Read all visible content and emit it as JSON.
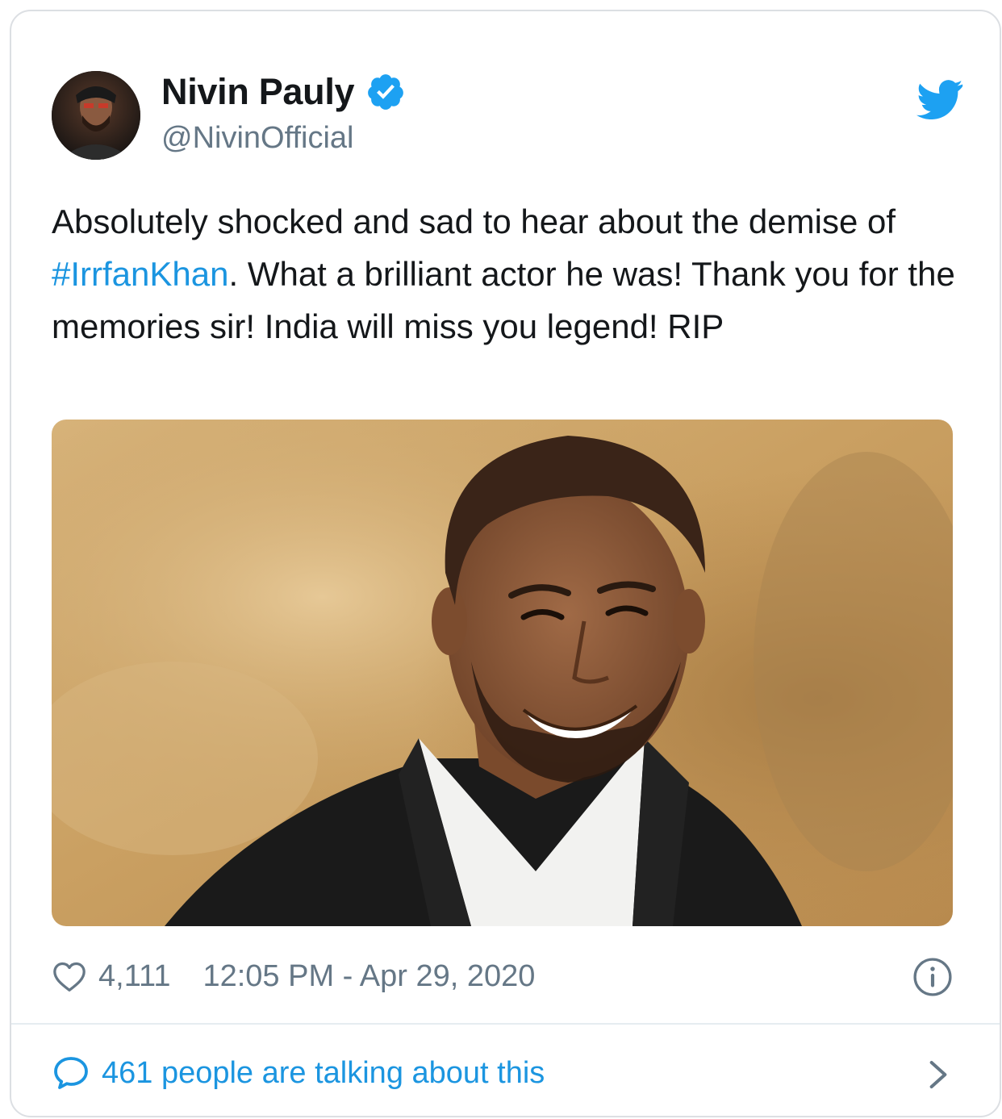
{
  "tweet": {
    "author": {
      "name": "Nivin Pauly",
      "handle": "@NivinOfficial",
      "verified": true,
      "avatar_icon": "profile-photo"
    },
    "text_parts": {
      "line_a": "Absolutely shocked and sad to hear about the demise of ",
      "hashtag": "#IrrfanKhan",
      "line_b": ". What a brilliant actor he was! Thank you for the memories sir! India will miss you legend! RIP"
    },
    "media": {
      "type": "photo",
      "subject": "smiling man in black blazer and white shirt against sandy rock background"
    },
    "likes": "4,111",
    "timestamp": "12:05 PM - Apr 29, 2020",
    "talking": "461 people are talking about this"
  },
  "colors": {
    "twitter_blue": "#1b95e0",
    "verified_blue": "#1da1f2",
    "text_primary": "#14171a",
    "text_secondary": "#657786",
    "border": "#dcdfe3"
  },
  "icons": {
    "brand": "twitter-bird-icon",
    "verified": "verified-badge-icon",
    "like": "heart-icon",
    "info": "info-icon",
    "reply": "speech-bubble-icon",
    "more": "chevron-right-icon"
  }
}
